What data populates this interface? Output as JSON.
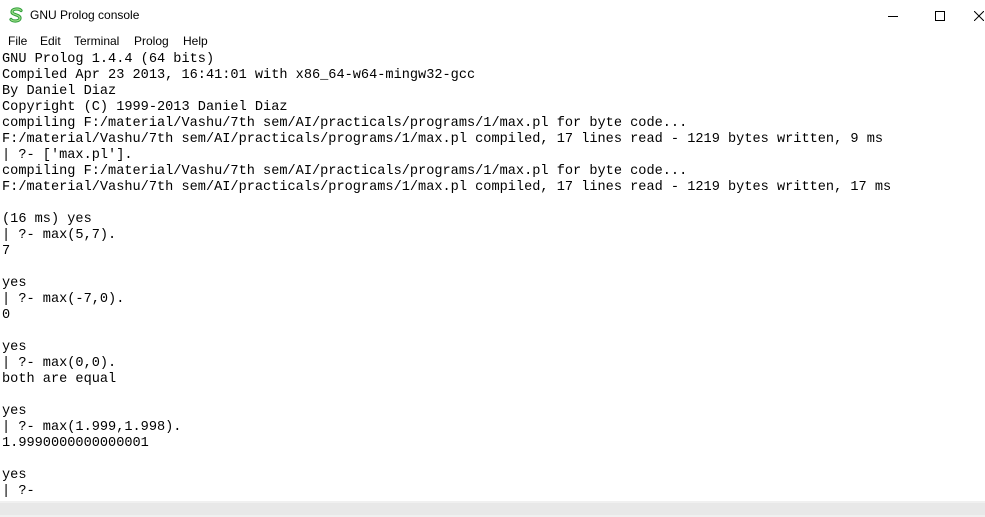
{
  "window": {
    "title": "GNU Prolog console",
    "icon": "gnu-prolog-s-icon",
    "controls": [
      "minimize-icon",
      "maximize-icon",
      "close-icon"
    ]
  },
  "menu": [
    {
      "label": "File"
    },
    {
      "label": "Edit"
    },
    {
      "label": "Terminal"
    },
    {
      "label": "Prolog"
    },
    {
      "label": "Help"
    }
  ],
  "console": {
    "lines": [
      "GNU Prolog 1.4.4 (64 bits)",
      "Compiled Apr 23 2013, 16:41:01 with x86_64-w64-mingw32-gcc",
      "By Daniel Diaz",
      "Copyright (C) 1999-2013 Daniel Diaz",
      "compiling F:/material/Vashu/7th sem/AI/practicals/programs/1/max.pl for byte code...",
      "F:/material/Vashu/7th sem/AI/practicals/programs/1/max.pl compiled, 17 lines read - 1219 bytes written, 9 ms",
      "| ?- ['max.pl'].",
      "compiling F:/material/Vashu/7th sem/AI/practicals/programs/1/max.pl for byte code...",
      "F:/material/Vashu/7th sem/AI/practicals/programs/1/max.pl compiled, 17 lines read - 1219 bytes written, 17 ms",
      "",
      "(16 ms) yes",
      "| ?- max(5,7).",
      "7",
      "",
      "yes",
      "| ?- max(-7,0).",
      "0",
      "",
      "yes",
      "| ?- max(0,0).",
      "both are equal",
      "",
      "yes",
      "| ?- max(1.999,1.998).",
      "1.9990000000000001",
      "",
      "yes",
      "| ?-"
    ]
  }
}
